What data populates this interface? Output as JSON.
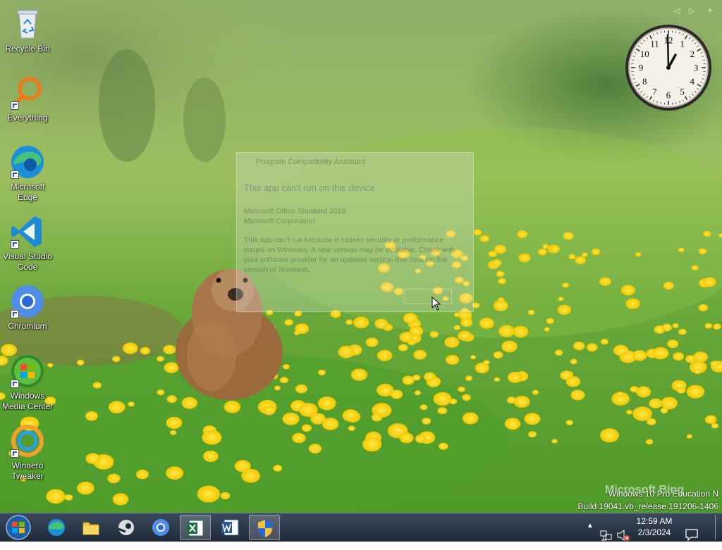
{
  "desktop": {
    "icons": [
      {
        "label": "Recycle Bin"
      },
      {
        "label": "Everything"
      },
      {
        "label": "Microsoft Edge"
      },
      {
        "label": "Visual Studio Code"
      },
      {
        "label": "Chromium"
      },
      {
        "label": "Windows Media Center"
      },
      {
        "label": "Winaero Tweaker"
      }
    ]
  },
  "ghost_dialog": {
    "title": "Program Compatibility Assistant",
    "heading": "This app can't run on this device",
    "app_name": "Microsoft Office Standard 2010",
    "publisher": "Microsoft Corporation",
    "body": "This app can't run because it causes security or performance issues on Windows. A new version may be available. Check with your software provider for an updated version that runs on this version of Windows."
  },
  "watermark": {
    "edition": "Windows 10 Pro Education N",
    "build": "Build 19041.vb_release.191206-1406",
    "bing": "Microsoft Bing"
  },
  "clock_gadget": {
    "numbers": [
      "12",
      "1",
      "2",
      "3",
      "4",
      "5",
      "6",
      "7",
      "8",
      "9",
      "10",
      "11"
    ]
  },
  "taskbar": {
    "clock_time": "12:59 AM",
    "clock_date": "2/3/2024"
  },
  "colors": {
    "taskbar": "#26323f",
    "flowers": "#f5d200",
    "grass": "#5aa832"
  }
}
